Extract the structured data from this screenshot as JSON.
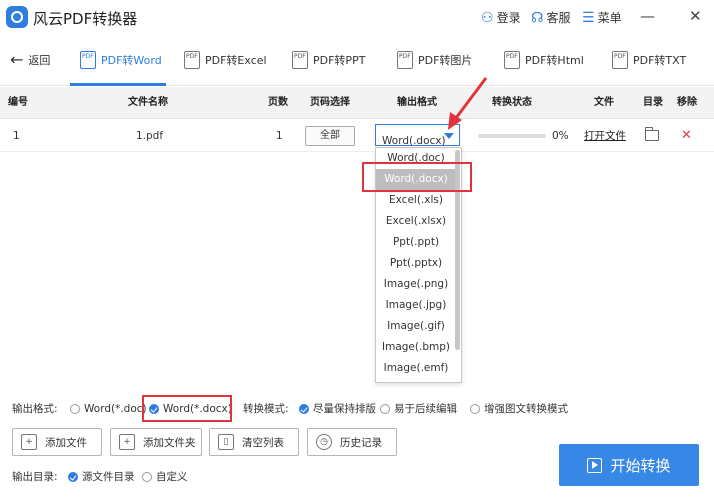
{
  "app": {
    "title": "风云PDF转换器"
  },
  "titlebar": {
    "login": "登录",
    "service": "客服",
    "menu": "菜单",
    "minimize": "—",
    "close": "✕"
  },
  "tabs": {
    "back": "返回",
    "items": [
      {
        "label": "PDF转Word",
        "active": true
      },
      {
        "label": "PDF转Excel"
      },
      {
        "label": "PDF转PPT"
      },
      {
        "label": "PDF转图片"
      },
      {
        "label": "PDF转Html"
      },
      {
        "label": "PDF转TXT"
      }
    ]
  },
  "table": {
    "headers": {
      "index": "编号",
      "name": "文件名称",
      "pages": "页数",
      "page_select": "页码选择",
      "format": "输出格式",
      "status": "转换状态",
      "file": "文件",
      "dir": "目录",
      "remove": "移除"
    },
    "row": {
      "index": "1",
      "name": "1.pdf",
      "pages": "1",
      "page_btn": "全部",
      "format": "Word(.docx)",
      "progress": 0,
      "progress_text": "0%",
      "open": "打开文件",
      "remove": "✕"
    }
  },
  "dropdown": {
    "options": [
      "Word(.doc)",
      "Word(.docx)",
      "Excel(.xls)",
      "Excel(.xlsx)",
      "Ppt(.ppt)",
      "Ppt(.pptx)",
      "Image(.png)",
      "Image(.jpg)",
      "Image(.gif)",
      "Image(.bmp)",
      "Image(.emf)"
    ],
    "selected_index": 1
  },
  "options": {
    "format_label": "输出格式:",
    "format_doc": "Word(*.doc)",
    "format_docx": "Word(*.docx)",
    "mode_label": "转换模式:",
    "mode_1": "尽量保持排版",
    "mode_2": "易于后续编辑",
    "mode_3": "增强图文转换模式"
  },
  "buttons": {
    "add_file": "添加文件",
    "add_folder": "添加文件夹",
    "clear": "清空列表",
    "history": "历史记录",
    "start": "开始转换"
  },
  "output_dir": {
    "label": "输出目录:",
    "source": "源文件目录",
    "custom": "自定义"
  },
  "colors": {
    "accent": "#2f7de1",
    "highlight": "#e2333b"
  }
}
